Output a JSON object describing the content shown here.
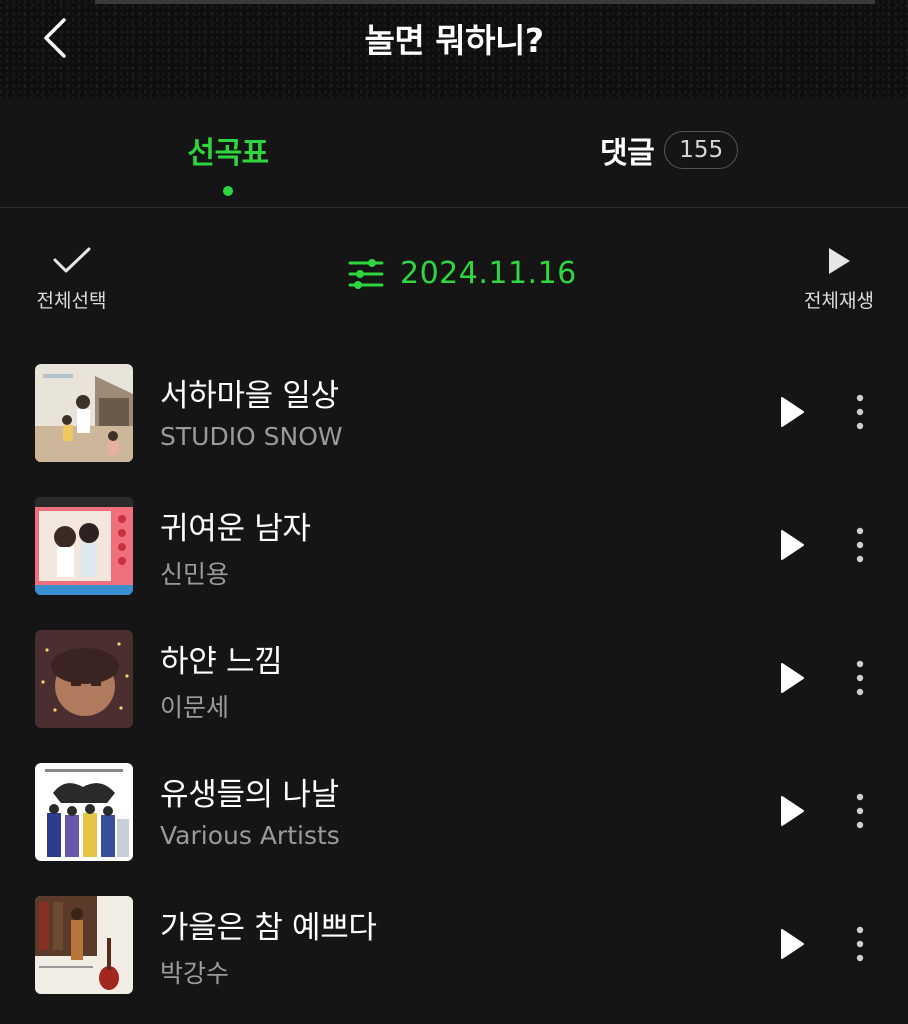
{
  "header": {
    "title": "놀면 뭐하니?",
    "back_icon": "back-chevron-icon"
  },
  "tabs": [
    {
      "label": "선곡표",
      "active": true
    },
    {
      "label": "댓글",
      "count": "155",
      "active": false
    }
  ],
  "toolbar": {
    "select_all_label": "전체선택",
    "date": "2024.11.16",
    "play_all_label": "전체재생"
  },
  "songs": [
    {
      "title": "서하마을 일상",
      "artist": "STUDIO SNOW"
    },
    {
      "title": "귀여운 남자",
      "artist": "신민용"
    },
    {
      "title": "하얀 느낌",
      "artist": "이문세"
    },
    {
      "title": "유생들의 나날",
      "artist": "Various Artists"
    },
    {
      "title": "가을은 참 예쁘다",
      "artist": "박강수"
    }
  ],
  "colors": {
    "accent": "#2fd63f",
    "background": "#151515",
    "secondary_text": "#9a9a9a"
  }
}
